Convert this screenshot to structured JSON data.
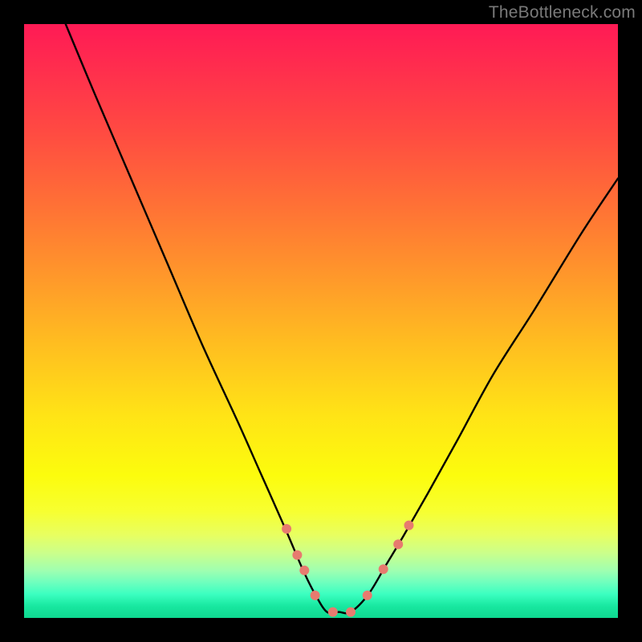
{
  "watermark": "TheBottleneck.com",
  "chart_data": {
    "type": "line",
    "title": "",
    "xlabel": "",
    "ylabel": "",
    "xlim": [
      0,
      100
    ],
    "ylim": [
      0,
      100
    ],
    "grid": false,
    "legend": false,
    "series": [
      {
        "name": "curve",
        "color": "#000000",
        "x": [
          7,
          12,
          18,
          24,
          30,
          36,
          40,
          44,
          47,
          49,
          51,
          53,
          55,
          58,
          61,
          64,
          68,
          73,
          79,
          86,
          94,
          100
        ],
        "values": [
          100,
          88,
          74,
          60,
          46,
          33,
          24,
          15,
          8,
          4,
          1,
          1,
          1,
          4,
          9,
          14,
          21,
          30,
          41,
          52,
          65,
          74
        ]
      }
    ],
    "markers": {
      "name": "coral-dots",
      "color": "#e77b6f",
      "radius_px": 6,
      "x": [
        44.2,
        46.0,
        47.2,
        49.0,
        52.0,
        55.0,
        57.8,
        60.5,
        63.0,
        64.8
      ],
      "values": [
        15.0,
        10.6,
        8.0,
        3.8,
        1.0,
        1.0,
        3.8,
        8.2,
        12.4,
        15.6
      ]
    },
    "background_gradient": {
      "direction": "vertical",
      "stops": [
        {
          "pos": 0.0,
          "color": "#ff1a55"
        },
        {
          "pos": 0.3,
          "color": "#ff6f36"
        },
        {
          "pos": 0.66,
          "color": "#ffe416"
        },
        {
          "pos": 0.82,
          "color": "#f7ff30"
        },
        {
          "pos": 0.94,
          "color": "#6fffbe"
        },
        {
          "pos": 1.0,
          "color": "#0fd890"
        }
      ]
    }
  }
}
